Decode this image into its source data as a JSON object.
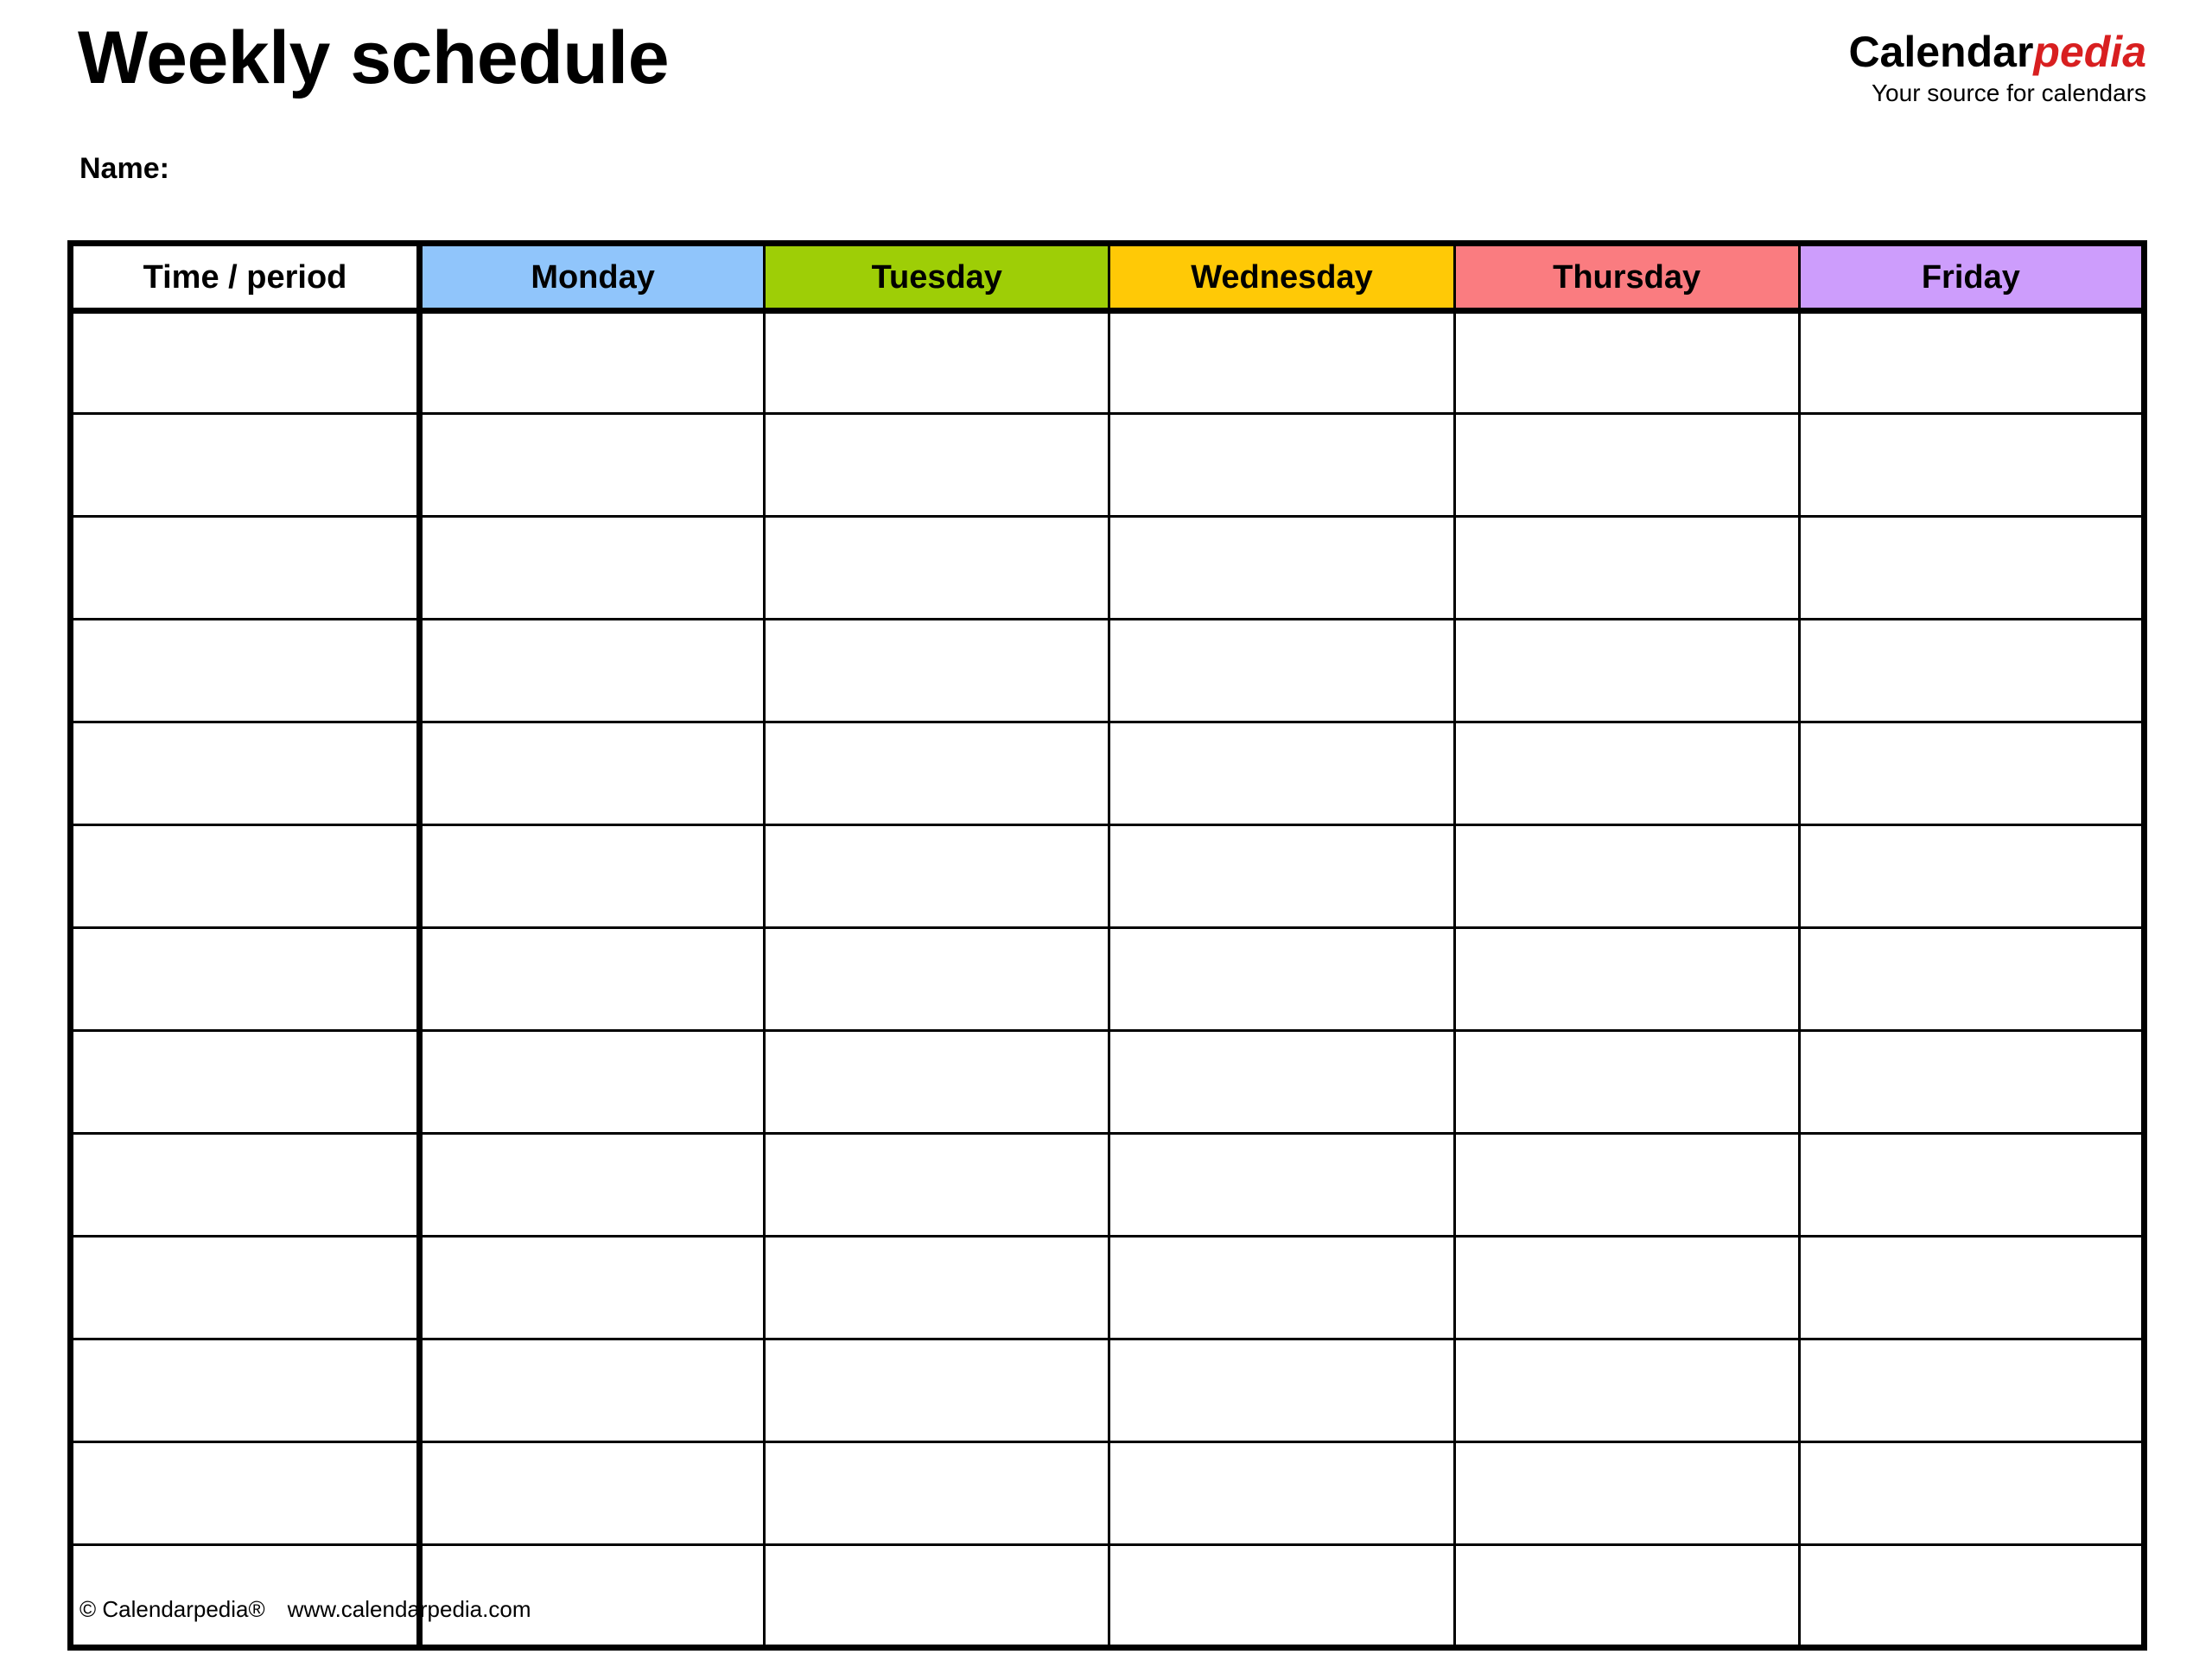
{
  "document": {
    "title": "Weekly schedule",
    "name_label": "Name:"
  },
  "brand": {
    "name_part1": "Calendar",
    "name_part2": "pedia",
    "tagline": "Your source for calendars",
    "accent_color": "#d81f20"
  },
  "schedule": {
    "columns": [
      {
        "label": "Time / period",
        "color": "#ffffff"
      },
      {
        "label": "Monday",
        "color": "#90c5fb"
      },
      {
        "label": "Tuesday",
        "color": "#9ece06"
      },
      {
        "label": "Wednesday",
        "color": "#ffc906"
      },
      {
        "label": "Thursday",
        "color": "#fa7c80"
      },
      {
        "label": "Friday",
        "color": "#cd9dfc"
      }
    ],
    "row_count": 13,
    "rows": [
      {
        "time": "",
        "monday": "",
        "tuesday": "",
        "wednesday": "",
        "thursday": "",
        "friday": ""
      },
      {
        "time": "",
        "monday": "",
        "tuesday": "",
        "wednesday": "",
        "thursday": "",
        "friday": ""
      },
      {
        "time": "",
        "monday": "",
        "tuesday": "",
        "wednesday": "",
        "thursday": "",
        "friday": ""
      },
      {
        "time": "",
        "monday": "",
        "tuesday": "",
        "wednesday": "",
        "thursday": "",
        "friday": ""
      },
      {
        "time": "",
        "monday": "",
        "tuesday": "",
        "wednesday": "",
        "thursday": "",
        "friday": ""
      },
      {
        "time": "",
        "monday": "",
        "tuesday": "",
        "wednesday": "",
        "thursday": "",
        "friday": ""
      },
      {
        "time": "",
        "monday": "",
        "tuesday": "",
        "wednesday": "",
        "thursday": "",
        "friday": ""
      },
      {
        "time": "",
        "monday": "",
        "tuesday": "",
        "wednesday": "",
        "thursday": "",
        "friday": ""
      },
      {
        "time": "",
        "monday": "",
        "tuesday": "",
        "wednesday": "",
        "thursday": "",
        "friday": ""
      },
      {
        "time": "",
        "monday": "",
        "tuesday": "",
        "wednesday": "",
        "thursday": "",
        "friday": ""
      },
      {
        "time": "",
        "monday": "",
        "tuesday": "",
        "wednesday": "",
        "thursday": "",
        "friday": ""
      },
      {
        "time": "",
        "monday": "",
        "tuesday": "",
        "wednesday": "",
        "thursday": "",
        "friday": ""
      },
      {
        "time": "",
        "monday": "",
        "tuesday": "",
        "wednesday": "",
        "thursday": "",
        "friday": ""
      }
    ]
  },
  "footer": {
    "copyright": "© Calendarpedia®",
    "website": "www.calendarpedia.com"
  }
}
